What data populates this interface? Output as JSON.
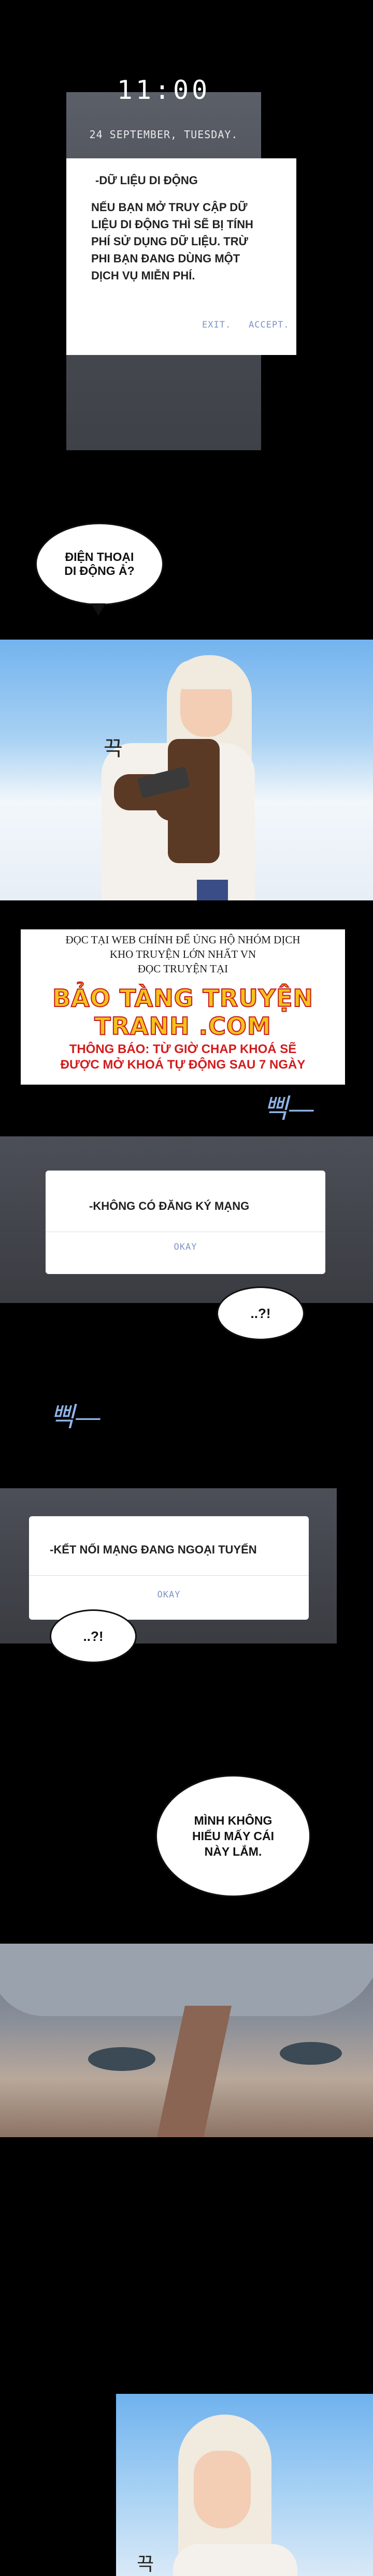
{
  "phone": {
    "time": "11:00",
    "date": "24 SEPTEMBER, TUESDAY."
  },
  "dialog_mobile_data": {
    "title": "-DỮ LIỆU DI ĐỘNG",
    "body_lines": [
      "NẾU BẠN MỞ TRUY CẬP DỮ",
      "LIỆU DI ĐỘNG THÌ SẼ BỊ TÍNH",
      "PHÍ SỬ DỤNG DỮ LIỆU. TRỪ",
      "PHI BẠN ĐANG DÙNG MỘT",
      "DỊCH VỤ MIỄN PHÍ."
    ],
    "exit_label": "EXIT.",
    "accept_label": "ACCEPT."
  },
  "bubble_phone": {
    "line1": "ĐIỆN THOẠI",
    "line2": "DI ĐỘNG Ả?"
  },
  "sfx_1": "끅",
  "ad": {
    "line1": "ĐỌC TẠI WEB CHÍNH ĐỂ ỦNG HỘ NHÓM DỊCH",
    "line2": "KHO TRUYỆN LỚN NHẤT VN",
    "line3": "ĐỌC TRUYỆN TẠI",
    "logo": "BẢO TÀNG TRUYỆN TRANH .COM",
    "notice1": "THÔNG BÁO: TỪ GIỜ CHAP KHOÁ SẼ",
    "notice2": "ĐƯỢC MỞ KHOÁ TỰ ĐỘNG SAU 7 NGÀY"
  },
  "sfx_2": "삑—",
  "dialog_no_network": {
    "title": "-KHÔNG CÓ ĐĂNG KÝ MẠNG",
    "ok_label": "OKAY"
  },
  "bubble_q1": "..?!",
  "sfx_3": "삑—",
  "dialog_offline": {
    "title": "-KẾT NỐI MẠNG ĐANG NGOẠI TUYẾN",
    "ok_label": "OKAY"
  },
  "bubble_q2": "..?!",
  "bubble_dunno": {
    "line1": "MÌNH KHÔNG",
    "line2": "HIỂU MẤY CÁI",
    "line3": "NÀY LẮM."
  },
  "sfx_4": "끅"
}
